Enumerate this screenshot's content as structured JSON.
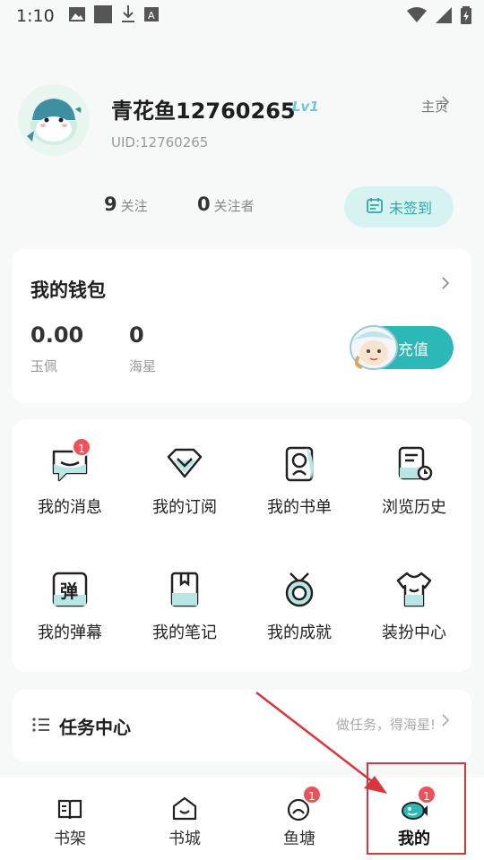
{
  "status_bar": {
    "time": "1:10"
  },
  "profile": {
    "username": "青花鱼12760265",
    "level": "Lv1",
    "uid": "UID:12760265",
    "homepage_label": "主页",
    "following_count": "9",
    "following_label": "关注",
    "followers_count": "0",
    "followers_label": "关注者",
    "checkin_label": "未签到"
  },
  "wallet": {
    "title": "我的钱包",
    "jade_value": "0.00",
    "jade_label": "玉佩",
    "star_value": "0",
    "star_label": "海星",
    "recharge_label": "充值"
  },
  "menu": {
    "items": [
      {
        "label": "我的消息",
        "badge": "1",
        "icon": "message-icon"
      },
      {
        "label": "我的订阅",
        "icon": "subscribe-icon"
      },
      {
        "label": "我的书单",
        "icon": "booklist-icon"
      },
      {
        "label": "浏览历史",
        "icon": "history-icon"
      },
      {
        "label": "我的弹幕",
        "icon_char": "弹",
        "icon": "danmaku-icon"
      },
      {
        "label": "我的笔记",
        "icon": "notes-icon"
      },
      {
        "label": "我的成就",
        "icon": "achievement-icon"
      },
      {
        "label": "装扮中心",
        "icon": "outfit-icon"
      }
    ]
  },
  "task": {
    "title": "任务中心",
    "hint": "做任务，得海星!"
  },
  "bottom_nav": {
    "items": [
      {
        "label": "书架",
        "icon": "bookshelf-icon"
      },
      {
        "label": "书城",
        "icon": "bookstore-icon"
      },
      {
        "label": "鱼塘",
        "badge": "1",
        "icon": "fishpond-icon"
      },
      {
        "label": "我的",
        "badge": "1",
        "icon": "profile-fish-icon",
        "active": true
      }
    ]
  },
  "colors": {
    "accent": "#2bb8b6",
    "badge": "#f1505a",
    "highlight": "#d9353b"
  }
}
